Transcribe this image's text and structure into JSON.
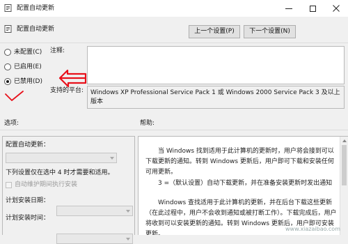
{
  "window": {
    "title": "配置自动更新",
    "icon": "policy-icon"
  },
  "header": {
    "title": "配置自动更新",
    "prev_button": "上一个设置(P)",
    "next_button": "下一个设置(N)"
  },
  "state": {
    "options": [
      {
        "label": "未配置(C)",
        "checked": false
      },
      {
        "label": "已启用(E)",
        "checked": false
      },
      {
        "label": "已禁用(D)",
        "checked": true
      }
    ]
  },
  "comment": {
    "label": "注释:",
    "value": ""
  },
  "supported": {
    "label": "支持的平台:",
    "value": "Windows XP Professional Service Pack 1 或 Windows 2000 Service Pack 3 及以上版本"
  },
  "options_section": {
    "label": "选项:",
    "configure_label": "配置自动更新：",
    "settings_note": "下列设置仅在选中 4 时才需要和适用。",
    "auto_maintenance_label": "自动维护期间执行安装",
    "install_day_label": "计划安装日期：",
    "install_time_label": "计划安装时间："
  },
  "help_section": {
    "label": "帮助:",
    "paragraphs": [
      "当 Windows 找到适用于此计算机的更新时，用户将会接到可以下载更新的通知。转到 Windows 更新后，用户即可下载和安装任何可用更新。",
      "3 =（默认设置）自动下载更新，并在准备安装更新时发出通知",
      "Windows 查找适用于此计算机的更新，并在后台下载这些更新（在此过程中，用户不会收到通知或被打断工作）。下载完成后，用户将收到可以安装更新的通知。转到 Windows 更新后，用户即可安装更新。"
    ]
  },
  "watermark": "www.xiazaibao.com",
  "colors": {
    "annotation": "#e8101a",
    "window_bg": "#f0f0f0"
  }
}
